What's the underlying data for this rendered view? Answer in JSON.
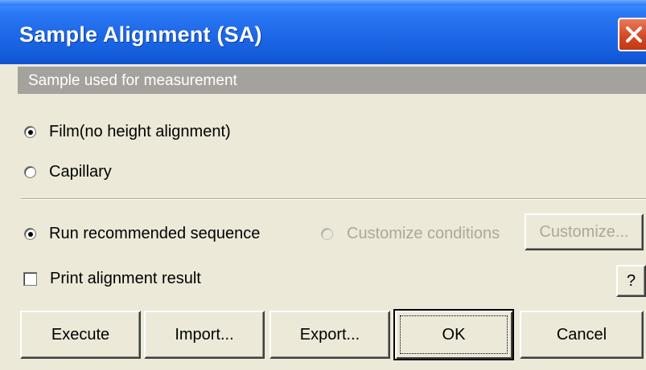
{
  "window": {
    "title": "Sample Alignment (SA)",
    "close_icon": "close-icon"
  },
  "sample_section": {
    "header": "Sample used for measurement",
    "options": [
      {
        "label": "Film(no height alignment)",
        "checked": true
      },
      {
        "label": "Capillary",
        "checked": false
      }
    ]
  },
  "sequence": {
    "run_recommended_label": "Run recommended sequence",
    "run_recommended_checked": true,
    "customize_conditions_label": "Customize conditions",
    "customize_conditions_enabled": false,
    "customize_button_label": "Customize...",
    "customize_button_enabled": false
  },
  "print": {
    "label": "Print alignment result",
    "checked": false,
    "help_label": "?"
  },
  "buttons": {
    "execute": "Execute",
    "import": "Import...",
    "export": "Export...",
    "ok": "OK",
    "cancel": "Cancel"
  },
  "colors": {
    "title_bar": "#1f6ae8",
    "close_button": "#d44a24",
    "section_header": "#a5a29e",
    "dialog_bg": "#ece9d8",
    "disabled_text": "#aca899"
  }
}
